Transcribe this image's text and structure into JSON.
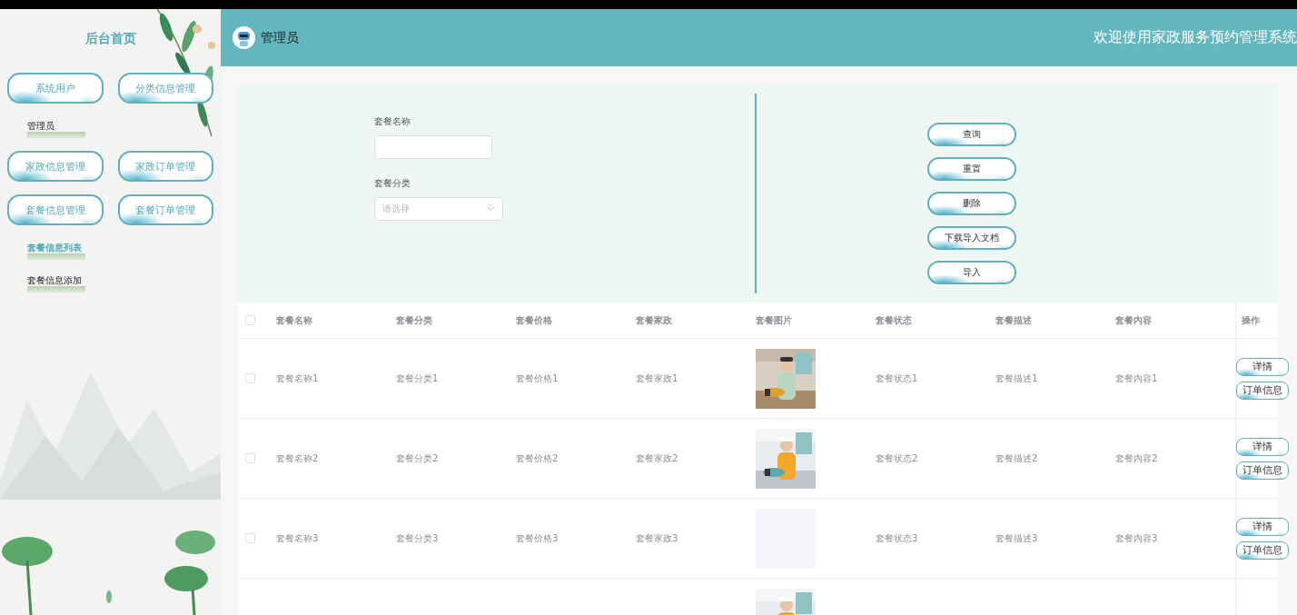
{
  "sidebar": {
    "title": "后台首页",
    "menu": [
      {
        "label": "系统用户",
        "children": [
          {
            "label": "管理员",
            "selected": false
          }
        ]
      },
      {
        "label": "分类信息管理"
      },
      {
        "label": "家政信息管理"
      },
      {
        "label": "家政订单管理"
      },
      {
        "label": "套餐信息管理",
        "children": [
          {
            "label": "套餐信息列表",
            "selected": true
          },
          {
            "label": "套餐信息添加",
            "selected": false
          }
        ]
      },
      {
        "label": "套餐订单管理"
      }
    ]
  },
  "header": {
    "user": "管理员",
    "title": "欢迎使用家政服务预约管理系统"
  },
  "search": {
    "fields": [
      {
        "kind": "text",
        "label": "套餐名称"
      },
      {
        "kind": "select",
        "label": "套餐分类",
        "placeholder": "请选择"
      }
    ],
    "buttons": [
      "查询",
      "重置",
      "删除",
      "下载导入文档",
      "导入"
    ]
  },
  "table": {
    "all_checked": false,
    "columns": [
      "套餐名称",
      "套餐分类",
      "套餐价格",
      "套餐家政",
      "套餐图片",
      "套餐状态",
      "套餐描述",
      "套餐内容",
      "操作"
    ],
    "rows": [
      {
        "checked": false,
        "cells": [
          "套餐名称1",
          "套餐分类1",
          "套餐价格1",
          "套餐家政1",
          "套餐状态1",
          "套餐描述1",
          "套餐内容1"
        ],
        "image": {
          "kind": "picture"
        },
        "actions": [
          "详情",
          "订单信息"
        ]
      },
      {
        "checked": false,
        "cells": [
          "套餐名称2",
          "套餐分类2",
          "套餐价格2",
          "套餐家政2",
          "套餐状态2",
          "套餐描述2",
          "套餐内容2"
        ],
        "image": {
          "kind": "picture"
        },
        "actions": [
          "详情",
          "订单信息"
        ]
      },
      {
        "checked": false,
        "cells": [
          "套餐名称3",
          "套餐分类3",
          "套餐价格3",
          "套餐家政3",
          "套餐状态3",
          "套餐描述3",
          "套餐内容3"
        ],
        "image": {
          "kind": "empty"
        },
        "actions": [
          "详情",
          "订单信息"
        ]
      },
      {
        "image": {
          "kind": "picture"
        }
      }
    ]
  }
}
